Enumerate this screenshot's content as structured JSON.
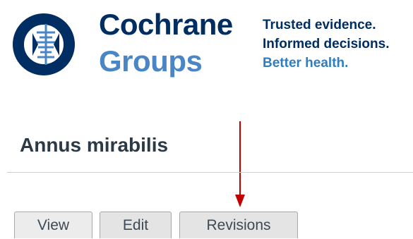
{
  "header": {
    "brand": {
      "line1": "Cochrane",
      "line2": "Groups"
    },
    "tagline": {
      "line1": "Trusted evidence.",
      "line2": "Informed decisions.",
      "line3": "Better health."
    }
  },
  "page": {
    "title": "Annus mirabilis"
  },
  "tabs": [
    {
      "label": "View"
    },
    {
      "label": "Edit"
    },
    {
      "label": "Revisions"
    }
  ],
  "colors": {
    "brand_dark": "#002d62",
    "brand_light": "#4a86c6",
    "arrow": "#c00000"
  }
}
